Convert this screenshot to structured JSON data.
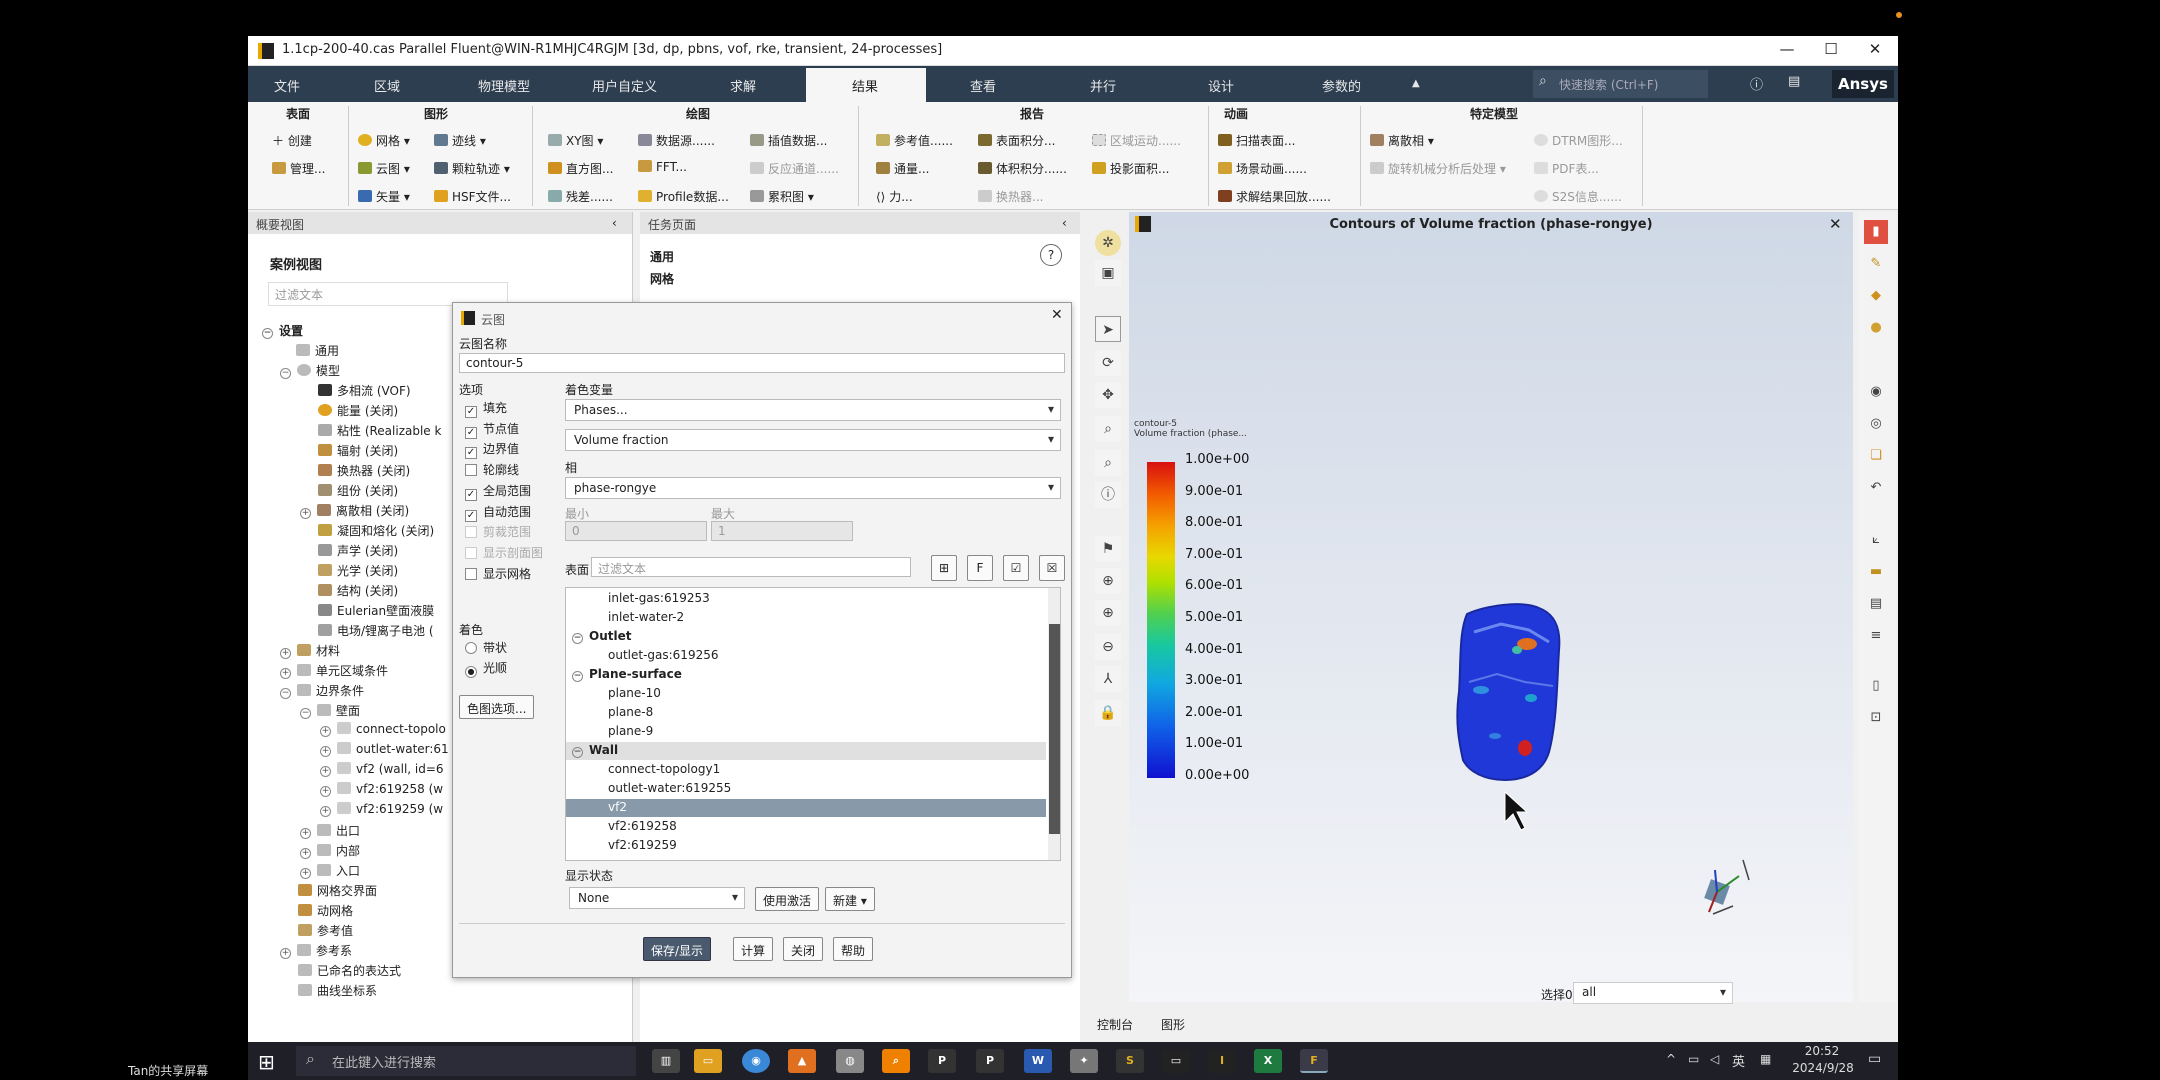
{
  "window": {
    "title": "1.1cp-200-40.cas Parallel Fluent@WIN-R1MHJC4RGJM  [3d, dp, pbns, vof, rke, transient, 24-processes]"
  },
  "menu": {
    "items": [
      "文件",
      "区域",
      "物理模型",
      "用户自定义",
      "求解",
      "结果",
      "查看",
      "并行",
      "设计",
      "参数的"
    ],
    "search_placeholder": "快速搜索 (Ctrl+F)",
    "brand": "Ansys"
  },
  "ribbon": {
    "groups": {
      "surface": "表面",
      "graphics": "图形",
      "plots": "绘图",
      "reports": "报告",
      "animation": "动画",
      "models": "特定模型"
    },
    "surface": [
      "创建",
      "管理..."
    ],
    "graphics": [
      "网格",
      "云图",
      "矢量",
      "迹线",
      "颗粒轨迹",
      "HSF文件..."
    ],
    "plots": [
      "XY图",
      "直方图...",
      "残差......",
      "数据源......",
      "FFT...",
      "Profile数据...",
      "插值数据...",
      "反应通道......",
      "累积图"
    ],
    "reports": [
      "参考值......",
      "通量...",
      "力...",
      "表面积分...",
      "体积积分......",
      "换热器...",
      "区域运动......",
      "投影面积..."
    ],
    "animation": [
      "扫描表面...",
      "场景动画......",
      "求解结果回放......"
    ],
    "models": [
      "离散相",
      "旋转机械分析后处理",
      "DTRM图形...",
      "PDF表...",
      "S2S信息......"
    ]
  },
  "outline": {
    "header": "概要视图",
    "case_view": "案例视图",
    "filter_placeholder": "过滤文本",
    "nodes": [
      "设置",
      "通用",
      "模型",
      "多相流 (VOF)",
      "能量 (关闭)",
      "粘性 (Realizable  k",
      "辐射 (关闭)",
      "换热器 (关闭)",
      "组份 (关闭)",
      "离散相 (关闭)",
      "凝固和熔化 (关闭)",
      "声学 (关闭)",
      "光学 (关闭)",
      "结构 (关闭)",
      "Eulerian壁面液膜",
      "电场/锂离子电池 (",
      "材料",
      "单元区域条件",
      "边界条件",
      "壁面",
      "connect-topolo",
      "outlet-water:61",
      "vf2 (wall, id=6",
      "vf2:619258 (w",
      "vf2:619259 (w",
      "出口",
      "内部",
      "入口",
      "网格交界面",
      "动网格",
      "参考值",
      "参考系",
      "已命名的表达式",
      "曲线坐标系"
    ]
  },
  "task_page": {
    "header": "任务页面",
    "section": "通用",
    "sub": "网格"
  },
  "dialog": {
    "title": "云图",
    "name_label": "云图名称",
    "name_value": "contour-5",
    "options_label": "选项",
    "options": [
      {
        "label": "填充",
        "checked": true
      },
      {
        "label": "节点值",
        "checked": true
      },
      {
        "label": "边界值",
        "checked": true
      },
      {
        "label": "轮廓线",
        "checked": false
      },
      {
        "label": "全局范围",
        "checked": true
      },
      {
        "label": "自动范围",
        "checked": true
      },
      {
        "label": "剪裁范围",
        "checked": false
      },
      {
        "label": "显示剖面图",
        "checked": false
      },
      {
        "label": "显示网格",
        "checked": false
      }
    ],
    "color_var_label": "着色变量",
    "color_var_1": "Phases...",
    "color_var_2": "Volume fraction",
    "phase_label": "相",
    "phase_value": "phase-rongye",
    "min_label": "最小",
    "max_label": "最大",
    "min_value": "0",
    "max_value": "1",
    "surfaces_label": "表面",
    "surfaces_filter": "过滤文本",
    "coloring_label": "着色",
    "coloring_options": [
      "带状",
      "光顺"
    ],
    "colormap_btn": "色图选项...",
    "surfaces": [
      {
        "text": "inlet-gas:619253",
        "kind": "item"
      },
      {
        "text": "inlet-water-2",
        "kind": "item"
      },
      {
        "text": "Outlet",
        "kind": "group"
      },
      {
        "text": "outlet-gas:619256",
        "kind": "item"
      },
      {
        "text": "Plane-surface",
        "kind": "group"
      },
      {
        "text": "plane-10",
        "kind": "item"
      },
      {
        "text": "plane-8",
        "kind": "item"
      },
      {
        "text": "plane-9",
        "kind": "item"
      },
      {
        "text": "Wall",
        "kind": "group"
      },
      {
        "text": "connect-topology1",
        "kind": "item"
      },
      {
        "text": "outlet-water:619255",
        "kind": "item"
      },
      {
        "text": "vf2",
        "kind": "selected"
      },
      {
        "text": "vf2:619258",
        "kind": "item"
      },
      {
        "text": "vf2:619259",
        "kind": "item"
      }
    ],
    "display_state_label": "显示状态",
    "display_state_value": "None",
    "use_active": "使用激活",
    "new": "新建",
    "buttons": [
      "保存/显示",
      "计算",
      "关闭",
      "帮助"
    ]
  },
  "graphics": {
    "title": "Contours of Volume fraction (phase-rongye)",
    "legend_name": "contour-5",
    "legend_sub": "Volume fraction (phase...",
    "legend_values": [
      "1.00e+00",
      "9.00e-01",
      "8.00e-01",
      "7.00e-01",
      "6.00e-01",
      "5.00e-01",
      "4.00e-01",
      "3.00e-01",
      "2.00e-01",
      "1.00e-01",
      "0.00e+00"
    ],
    "select_label": "选择0",
    "select_value": "all"
  },
  "bottom_tabs": [
    "控制台",
    "图形"
  ],
  "taskbar": {
    "share_label": "Tan的共享屏幕",
    "search_placeholder": "在此键入进行搜索",
    "ime": "英",
    "time": "20:52",
    "date": "2024/9/28"
  },
  "colors": {
    "menu_bg": "#2d3e50",
    "accent": "#e8a800",
    "selected": "#8899aa"
  }
}
